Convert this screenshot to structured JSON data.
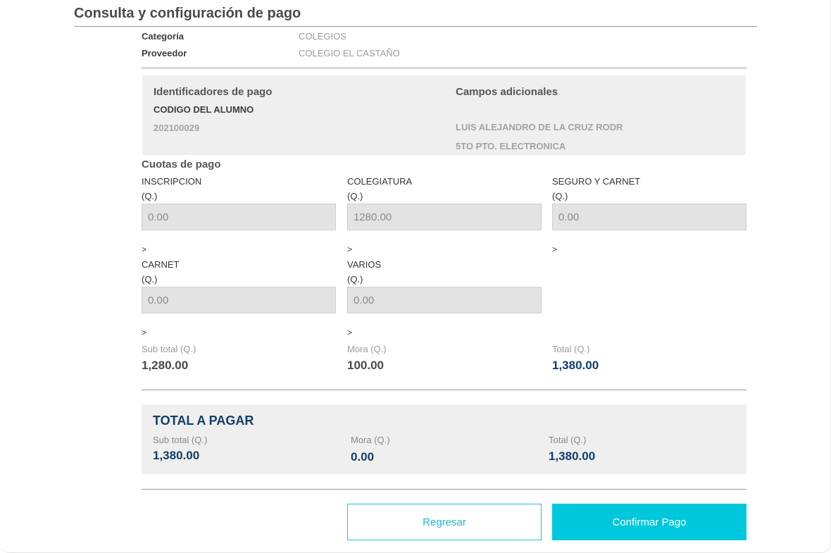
{
  "page": {
    "title": "Consulta y configuración de pago"
  },
  "provider_info": {
    "category_label": "Categoría",
    "category_value": "COLEGIOS",
    "provider_label": "Proveedor",
    "provider_value": "COLEGIO EL CASTAÑO"
  },
  "identifiers": {
    "title": "Identificadores de pago",
    "field_label": "CODIGO DEL ALUMNO",
    "field_value": "202100029"
  },
  "additional_fields": {
    "title": "Campos adicionales",
    "line1": "LUIS ALEJANDRO DE LA CRUZ RODR",
    "line2": "5TO PTO. ELECTRONICA"
  },
  "fees": {
    "title": "Cuotas de pago",
    "marker": ">",
    "currency_label": "(Q.)",
    "items": [
      {
        "label": "INSCRIPCION",
        "value": "0.00"
      },
      {
        "label": "COLEGIATURA",
        "value": "1280.00"
      },
      {
        "label": "SEGURO Y CARNET",
        "value": "0.00"
      },
      {
        "label": "CARNET",
        "value": "0.00"
      },
      {
        "label": "VARIOS",
        "value": "0.00"
      }
    ]
  },
  "summary": {
    "subtotal_label": "Sub total (Q.)",
    "subtotal_value": "1,280.00",
    "mora_label": "Mora (Q.)",
    "mora_value": "100.00",
    "total_label": "Total (Q.)",
    "total_value": "1,380.00"
  },
  "total_to_pay": {
    "title": "TOTAL A PAGAR",
    "subtotal_label": "Sub total (Q.)",
    "subtotal_value": "1,380.00",
    "mora_label": "Mora (Q.)",
    "mora_value": "0.00",
    "total_label": "Total (Q.)",
    "total_value": "1,380.00"
  },
  "actions": {
    "back_label": "Regresar",
    "confirm_label": "Confirmar Pago"
  },
  "colors": {
    "accent": "#00c8dc",
    "navy": "#123d6a",
    "panel": "#efefef"
  }
}
